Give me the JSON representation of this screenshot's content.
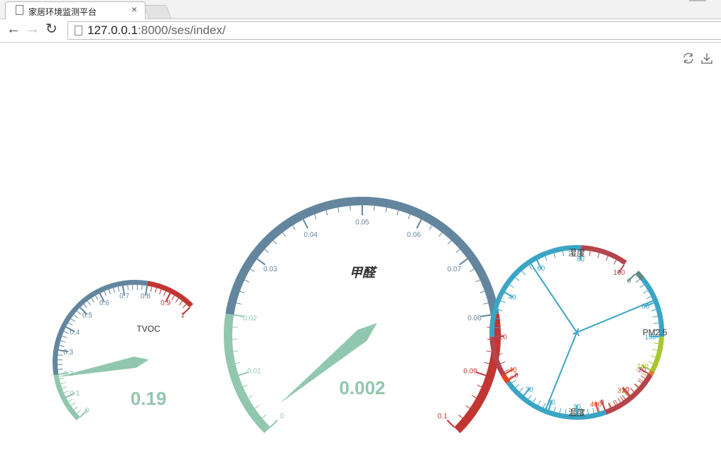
{
  "browser": {
    "tab_title": "家居环境监测平台",
    "tab_close": "×",
    "url_host": "127.0.0.1",
    "url_rest": ":8000/ses/index/"
  },
  "toolbox": {
    "refresh": "refresh-icon",
    "download": "download-icon"
  },
  "colors": {
    "green": "#91c7ae",
    "slate": "#63869e",
    "red": "#c23531",
    "cyan": "#3ba5c5",
    "darkred": "#b5444c"
  },
  "chart_data": [
    {
      "type": "gauge",
      "name": "TVOC",
      "min": 0,
      "max": 1,
      "value": 0.19,
      "value_label": "0.19",
      "tick_labels": [
        "0",
        "0.1",
        "0.2",
        "0.3",
        "0.4",
        "0.5",
        "0.6",
        "0.7",
        "0.8",
        "0.9",
        "1"
      ],
      "bands": [
        {
          "to": 0.2,
          "color": "#91c7ae"
        },
        {
          "to": 0.8,
          "color": "#63869e"
        },
        {
          "to": 1,
          "color": "#c23531"
        }
      ]
    },
    {
      "type": "gauge",
      "name": "甲醛",
      "min": 0,
      "max": 0.1,
      "value": 0.002,
      "value_label": "0.002",
      "tick_labels": [
        "0",
        "0.01",
        "0.02",
        "0.03",
        "0.04",
        "0.05",
        "0.06",
        "0.07",
        "0.08",
        "0.09",
        "0.1"
      ],
      "bands": [
        {
          "to": 0.02,
          "color": "#91c7ae"
        },
        {
          "to": 0.08,
          "color": "#63869e"
        },
        {
          "to": 0.1,
          "color": "#c23531"
        }
      ]
    },
    {
      "type": "gauge",
      "name": "湿度",
      "min": 0,
      "max": 100,
      "value": 57,
      "tick_labels": [
        "0",
        "20",
        "40",
        "60",
        "80",
        "100"
      ],
      "bands": [
        {
          "to": 20,
          "color": "#b5444c"
        },
        {
          "to": 80,
          "color": "#3ba5c5"
        },
        {
          "to": 100,
          "color": "#b5444c"
        }
      ]
    },
    {
      "type": "gauge",
      "name": "PM2.5",
      "min": 0,
      "max": 400,
      "value": 75,
      "tick_labels": [
        "0",
        "80",
        "160",
        "240",
        "320",
        "400"
      ],
      "bands": [
        {
          "to": 20,
          "color": "#5e8a86"
        },
        {
          "to": 160,
          "color": "#3ba5c5"
        },
        {
          "to": 240,
          "color": "#a5c82e"
        },
        {
          "to": 320,
          "color": "#d97d33"
        },
        {
          "to": 400,
          "color": "#e8441e"
        }
      ]
    },
    {
      "type": "gauge",
      "name": "温度",
      "min": -20,
      "max": 40,
      "value": 21,
      "tick_labels": [
        "-20",
        "-10",
        "0",
        "10",
        "20",
        "30",
        "40"
      ],
      "bands": [
        {
          "to": 37,
          "color": "#b5444c",
          "from_end": true
        },
        {
          "to": 0,
          "color": "#3ba5c5"
        },
        {
          "to": 40,
          "color": "#e8441e"
        }
      ]
    }
  ]
}
